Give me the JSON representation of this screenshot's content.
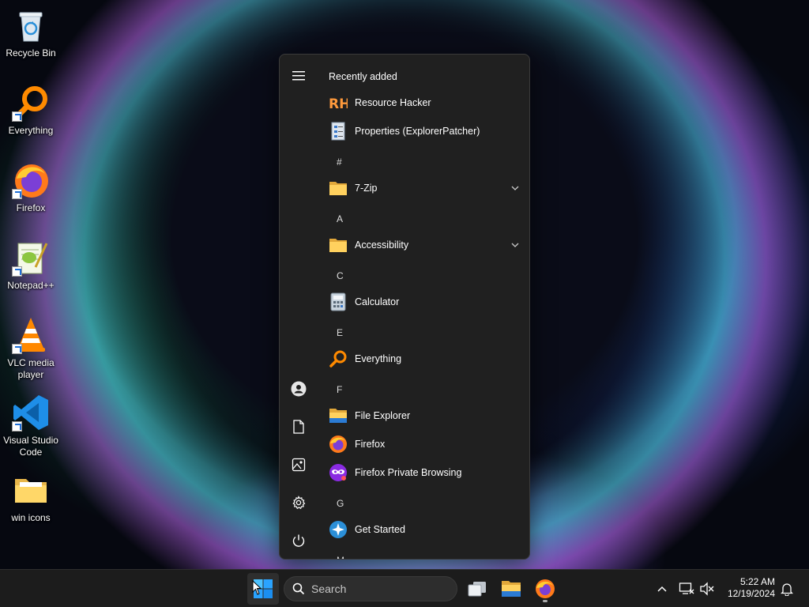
{
  "desktop": {
    "icons": [
      {
        "label": "Recycle Bin"
      },
      {
        "label": "Everything"
      },
      {
        "label": "Firefox"
      },
      {
        "label": "Notepad++"
      },
      {
        "label": "VLC media player"
      },
      {
        "label": "Visual Studio Code"
      },
      {
        "label": "win icons"
      }
    ]
  },
  "start_menu": {
    "recent_heading": "Recently added",
    "recent": [
      {
        "name": "Resource Hacker",
        "icon": "resource-hacker-icon"
      },
      {
        "name": "Properties (ExplorerPatcher)",
        "icon": "properties-icon"
      }
    ],
    "groups": [
      {
        "letter": "#",
        "apps": [
          {
            "name": "7-Zip",
            "icon": "folder-icon",
            "expandable": true
          }
        ]
      },
      {
        "letter": "A",
        "apps": [
          {
            "name": "Accessibility",
            "icon": "folder-icon",
            "expandable": true
          }
        ]
      },
      {
        "letter": "C",
        "apps": [
          {
            "name": "Calculator",
            "icon": "calculator-icon"
          }
        ]
      },
      {
        "letter": "E",
        "apps": [
          {
            "name": "Everything",
            "icon": "everything-icon"
          }
        ]
      },
      {
        "letter": "F",
        "apps": [
          {
            "name": "File Explorer",
            "icon": "file-explorer-icon"
          },
          {
            "name": "Firefox",
            "icon": "firefox-icon"
          },
          {
            "name": "Firefox Private Browsing",
            "icon": "firefox-private-icon"
          }
        ]
      },
      {
        "letter": "G",
        "apps": [
          {
            "name": "Get Started",
            "icon": "get-started-icon"
          }
        ]
      },
      {
        "letter": "M",
        "apps": []
      }
    ],
    "rail": [
      "menu-icon",
      "user-icon",
      "documents-icon",
      "pictures-icon",
      "settings-icon",
      "power-icon"
    ]
  },
  "taskbar": {
    "search_placeholder": "Search",
    "time": "5:22 AM",
    "date": "12/19/2024"
  }
}
